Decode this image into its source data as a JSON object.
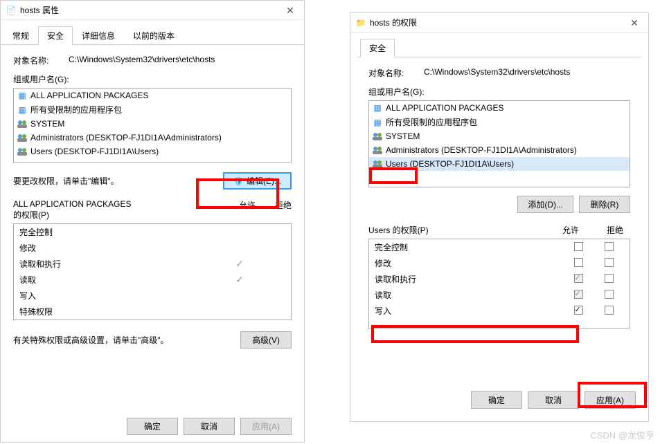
{
  "watermark": "CSDN @龙俊亨",
  "left": {
    "title": "hosts 属性",
    "tabs": [
      "常规",
      "安全",
      "详细信息",
      "以前的版本"
    ],
    "activeTab": 1,
    "objectNameLabel": "对象名称:",
    "objectName": "C:\\Windows\\System32\\drivers\\etc\\hosts",
    "groupsLabel": "组或用户名(G):",
    "principals": [
      "ALL APPLICATION PACKAGES",
      "所有受限制的应用程序包",
      "SYSTEM",
      "Administrators (DESKTOP-FJ1DI1A\\Administrators)",
      "Users (DESKTOP-FJ1DI1A\\Users)"
    ],
    "editHint": "要更改权限，请单击\"编辑\"。",
    "editBtn": "编辑(E)...",
    "permHeaderPrefix": "ALL APPLICATION PACKAGES",
    "permHeaderSuffix": "的权限(P)",
    "allowLabel": "允许",
    "denyLabel": "拒绝",
    "permissions": [
      {
        "name": "完全控制",
        "allow": false,
        "deny": false
      },
      {
        "name": "修改",
        "allow": false,
        "deny": false
      },
      {
        "name": "读取和执行",
        "allow": true,
        "deny": false
      },
      {
        "name": "读取",
        "allow": true,
        "deny": false
      },
      {
        "name": "写入",
        "allow": false,
        "deny": false
      },
      {
        "name": "特殊权限",
        "allow": false,
        "deny": false
      }
    ],
    "advancedHint": "有关特殊权限或高级设置，请单击\"高级\"。",
    "advancedBtn": "高级(V)",
    "okBtn": "确定",
    "cancelBtn": "取消",
    "applyBtn": "应用(A)"
  },
  "right": {
    "title": "hosts 的权限",
    "tabs": [
      "安全"
    ],
    "objectNameLabel": "对象名称:",
    "objectName": "C:\\Windows\\System32\\drivers\\etc\\hosts",
    "groupsLabel": "组或用户名(G):",
    "principals": [
      "ALL APPLICATION PACKAGES",
      "所有受限制的应用程序包",
      "SYSTEM",
      "Administrators (DESKTOP-FJ1DI1A\\Administrators)",
      "Users (DESKTOP-FJ1DI1A\\Users)"
    ],
    "selectedPrincipal": 4,
    "addBtn": "添加(D)...",
    "removeBtn": "删除(R)",
    "permHeader": "Users 的权限(P)",
    "allowLabel": "允许",
    "denyLabel": "拒绝",
    "permissions": [
      {
        "name": "完全控制",
        "allow": false,
        "deny": false,
        "grayed": false
      },
      {
        "name": "修改",
        "allow": false,
        "deny": false,
        "grayed": false
      },
      {
        "name": "读取和执行",
        "allow": true,
        "deny": false,
        "grayed": true
      },
      {
        "name": "读取",
        "allow": true,
        "deny": false,
        "grayed": true
      },
      {
        "name": "写入",
        "allow": true,
        "deny": false,
        "grayed": false
      }
    ],
    "okBtn": "确定",
    "cancelBtn": "取消",
    "applyBtn": "应用(A)"
  }
}
